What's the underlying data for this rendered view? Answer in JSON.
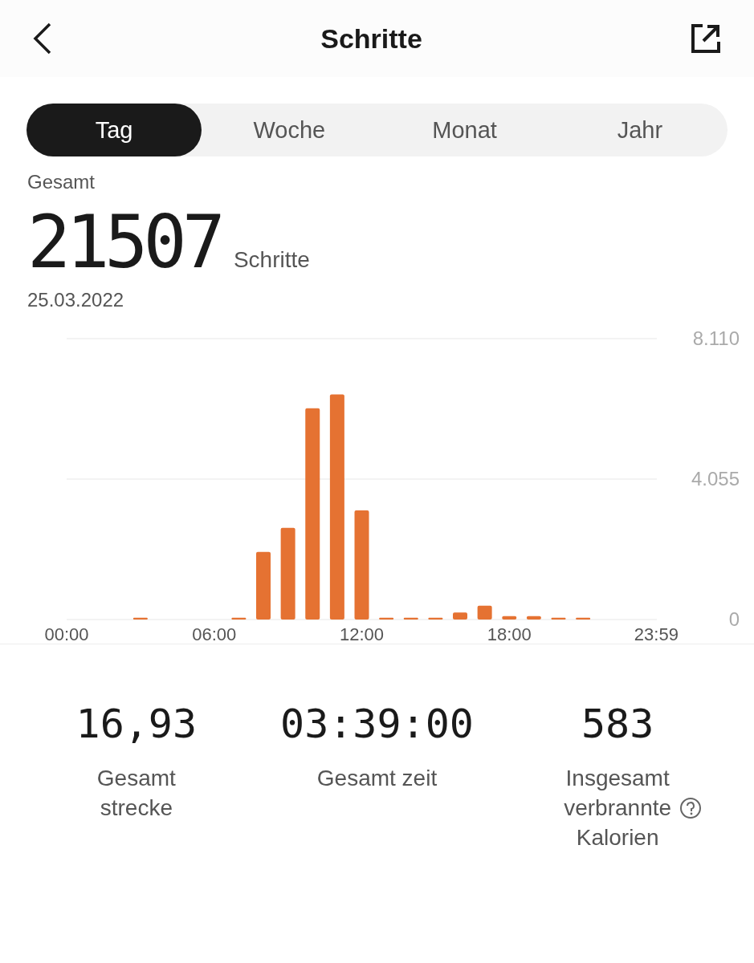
{
  "header": {
    "title": "Schritte"
  },
  "tabs": [
    {
      "label": "Tag",
      "selected": true
    },
    {
      "label": "Woche",
      "selected": false
    },
    {
      "label": "Monat",
      "selected": false
    },
    {
      "label": "Jahr",
      "selected": false
    }
  ],
  "summary": {
    "label": "Gesamt",
    "value": "21507",
    "unit": "Schritte",
    "date": "25.03.2022"
  },
  "chart_data": {
    "type": "bar",
    "x": [
      0,
      1,
      2,
      3,
      4,
      5,
      6,
      7,
      8,
      9,
      10,
      11,
      12,
      13,
      14,
      15,
      16,
      17,
      18,
      19,
      20,
      21,
      22,
      23
    ],
    "series": [
      {
        "color": "#e57232",
        "values": [
          0,
          0,
          0,
          50,
          0,
          0,
          0,
          50,
          1950,
          2650,
          6100,
          6500,
          3150,
          50,
          50,
          50,
          200,
          400,
          100,
          100,
          50,
          50,
          0,
          0
        ]
      }
    ],
    "xlim": [
      0,
      24
    ],
    "ylim": [
      0,
      8110
    ],
    "yticks": [
      {
        "value": 0,
        "label": "0"
      },
      {
        "value": 4055,
        "label": "4.055"
      },
      {
        "value": 8110,
        "label": "8.110"
      }
    ],
    "xticks": [
      {
        "value": 0,
        "label": "00:00"
      },
      {
        "value": 6,
        "label": "06:00"
      },
      {
        "value": 12,
        "label": "12:00"
      },
      {
        "value": 18,
        "label": "18:00"
      },
      {
        "value": 23.98,
        "label": "23:59"
      }
    ]
  },
  "stats": [
    {
      "value": "16,93",
      "label": "Gesamt strecke",
      "help": false
    },
    {
      "value": "03:39:00",
      "label": "Gesamt zeit",
      "help": false
    },
    {
      "value": "583",
      "label": "Insgesamt verbrannte Kalorien",
      "help": true
    }
  ]
}
